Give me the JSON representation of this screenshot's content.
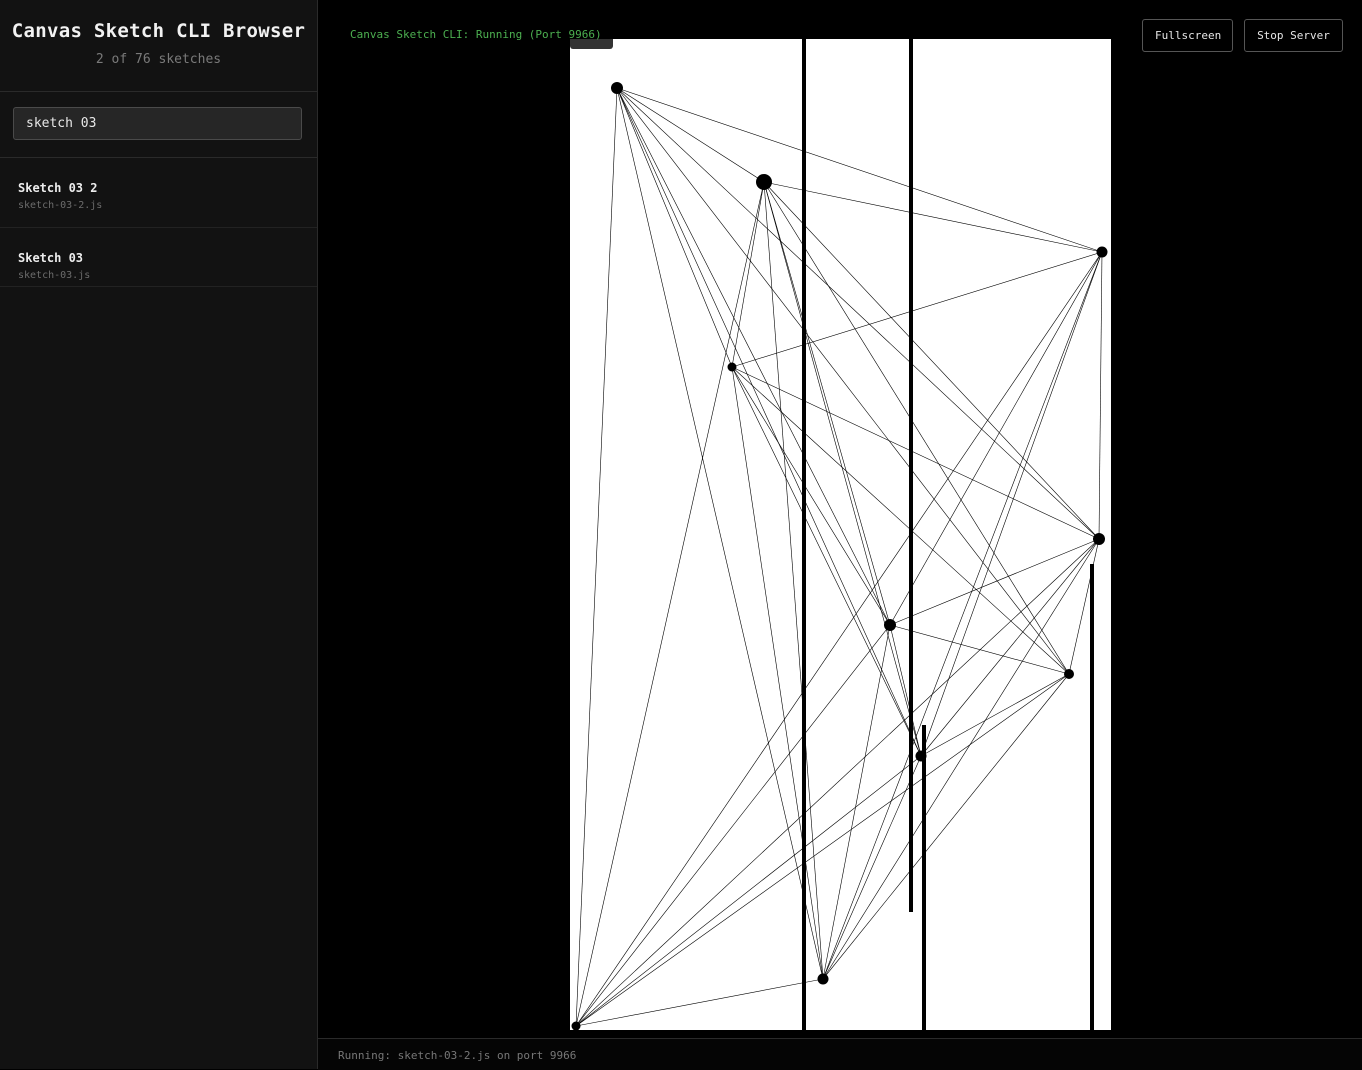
{
  "sidebar": {
    "title": "Canvas Sketch CLI Browser",
    "count_text": "2 of 76 sketches",
    "search": {
      "value": "sketch 03",
      "placeholder": ""
    },
    "items": [
      {
        "name": "Sketch 03 2",
        "file": "sketch-03-2.js"
      },
      {
        "name": "Sketch 03",
        "file": "sketch-03.js"
      }
    ]
  },
  "main": {
    "status": "Canvas Sketch CLI: Running (Port 9966)",
    "buttons": {
      "fullscreen": "Fullscreen",
      "stop": "Stop Server"
    },
    "footer": "Running: sketch-03-2.js on port 9966"
  },
  "colors": {
    "status_green": "#4caf50",
    "canvas_bg": "#ffffff",
    "ink": "#000000"
  }
}
